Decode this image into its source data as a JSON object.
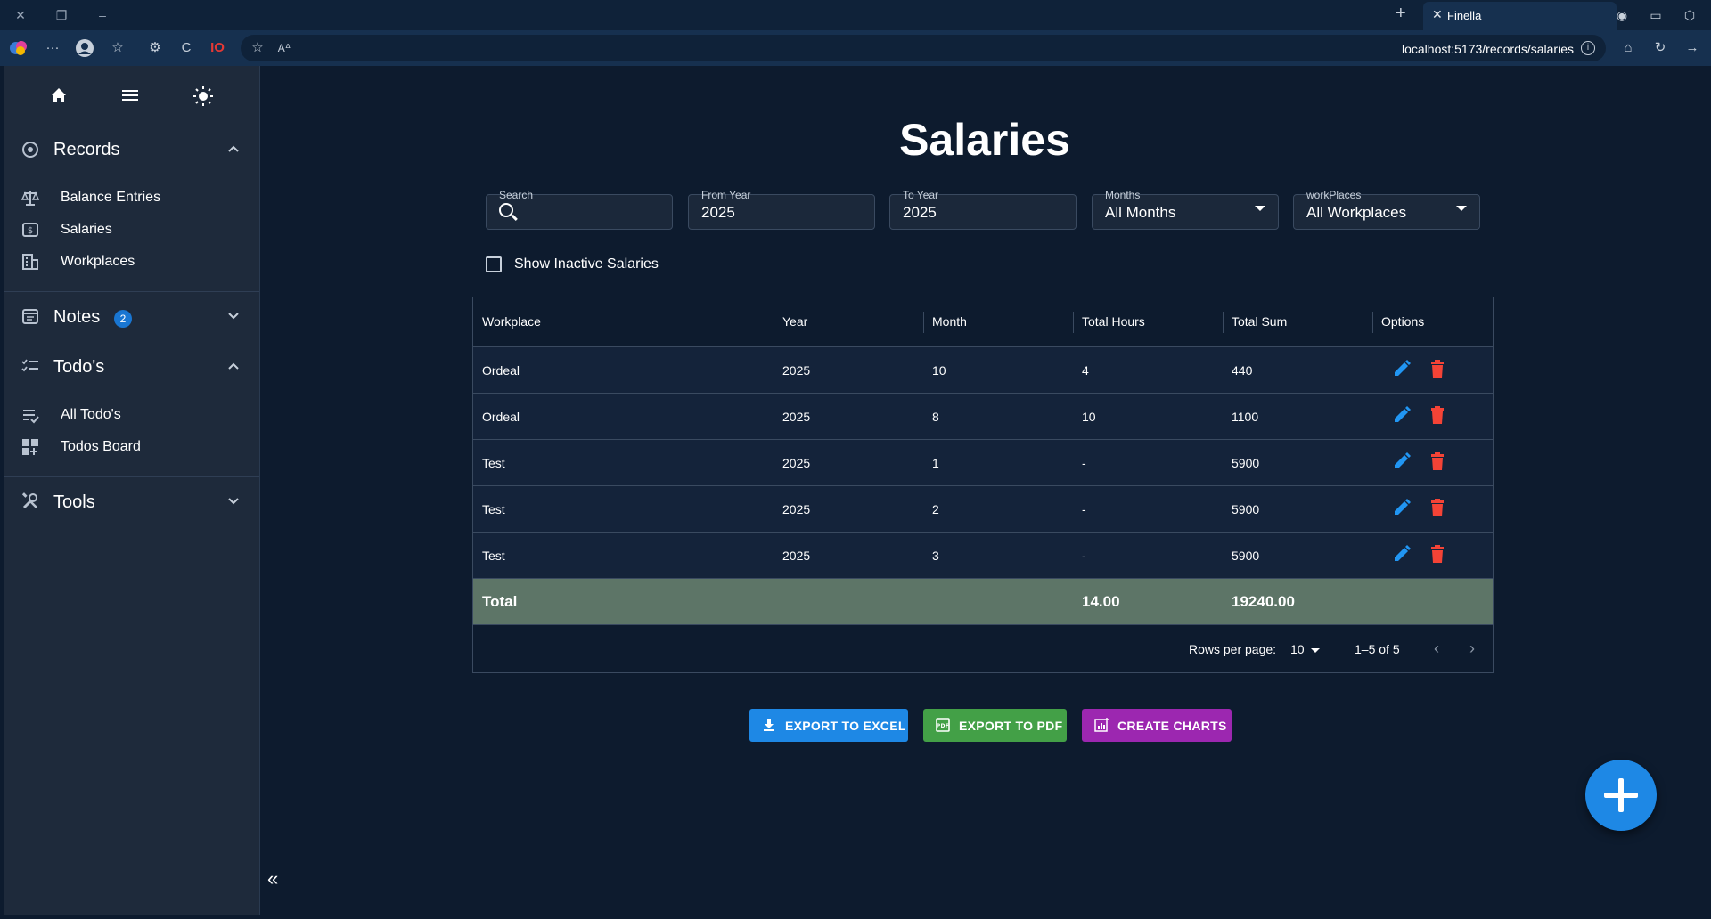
{
  "browser": {
    "tab_title": "Finella",
    "url": "localhost:5173/records/salaries",
    "profile_badge": "IO"
  },
  "sidebar": {
    "sections": [
      {
        "label": "Records",
        "items": [
          "Balance Entries",
          "Salaries",
          "Workplaces"
        ]
      },
      {
        "label": "Notes",
        "badge": "2"
      },
      {
        "label": "Todo's",
        "items": [
          "All Todo's",
          "Todos Board"
        ]
      },
      {
        "label": "Tools"
      }
    ]
  },
  "page": {
    "title": "Salaries"
  },
  "filters": {
    "search_label": "Search",
    "from_year_label": "From Year",
    "from_year_value": "2025",
    "to_year_label": "To Year",
    "to_year_value": "2025",
    "months_label": "Months",
    "months_value": "All Months",
    "workplaces_label": "workPlaces",
    "workplaces_value": "All Workplaces",
    "show_inactive_label": "Show Inactive Salaries"
  },
  "table": {
    "columns": [
      "Workplace",
      "Year",
      "Month",
      "Total Hours",
      "Total Sum",
      "Options"
    ],
    "rows": [
      [
        "Ordeal",
        "2025",
        "10",
        "4",
        "440"
      ],
      [
        "Ordeal",
        "2025",
        "8",
        "10",
        "1100"
      ],
      [
        "Test",
        "2025",
        "1",
        "-",
        "5900"
      ],
      [
        "Test",
        "2025",
        "2",
        "-",
        "5900"
      ],
      [
        "Test",
        "2025",
        "3",
        "-",
        "5900"
      ]
    ],
    "total": {
      "label": "Total",
      "hours": "14.00",
      "sum": "19240.00"
    },
    "pagination": {
      "rows_per_page_label": "Rows per page:",
      "rows_per_page": "10",
      "range": "1–5 of 5"
    }
  },
  "actions": {
    "export_excel": "EXPORT TO EXCEL",
    "export_pdf": "EXPORT TO PDF",
    "create_charts": "CREATE CHARTS"
  },
  "colors": {
    "background": "#0d1b2e",
    "sidebar": "#1e2a3b",
    "excel_button": "#1e88e5",
    "pdf_button": "#43a047",
    "charts_button": "#9c27b0",
    "delete_icon": "#f44336",
    "edit_icon": "#2196f3",
    "total_row": "#5d7567"
  }
}
